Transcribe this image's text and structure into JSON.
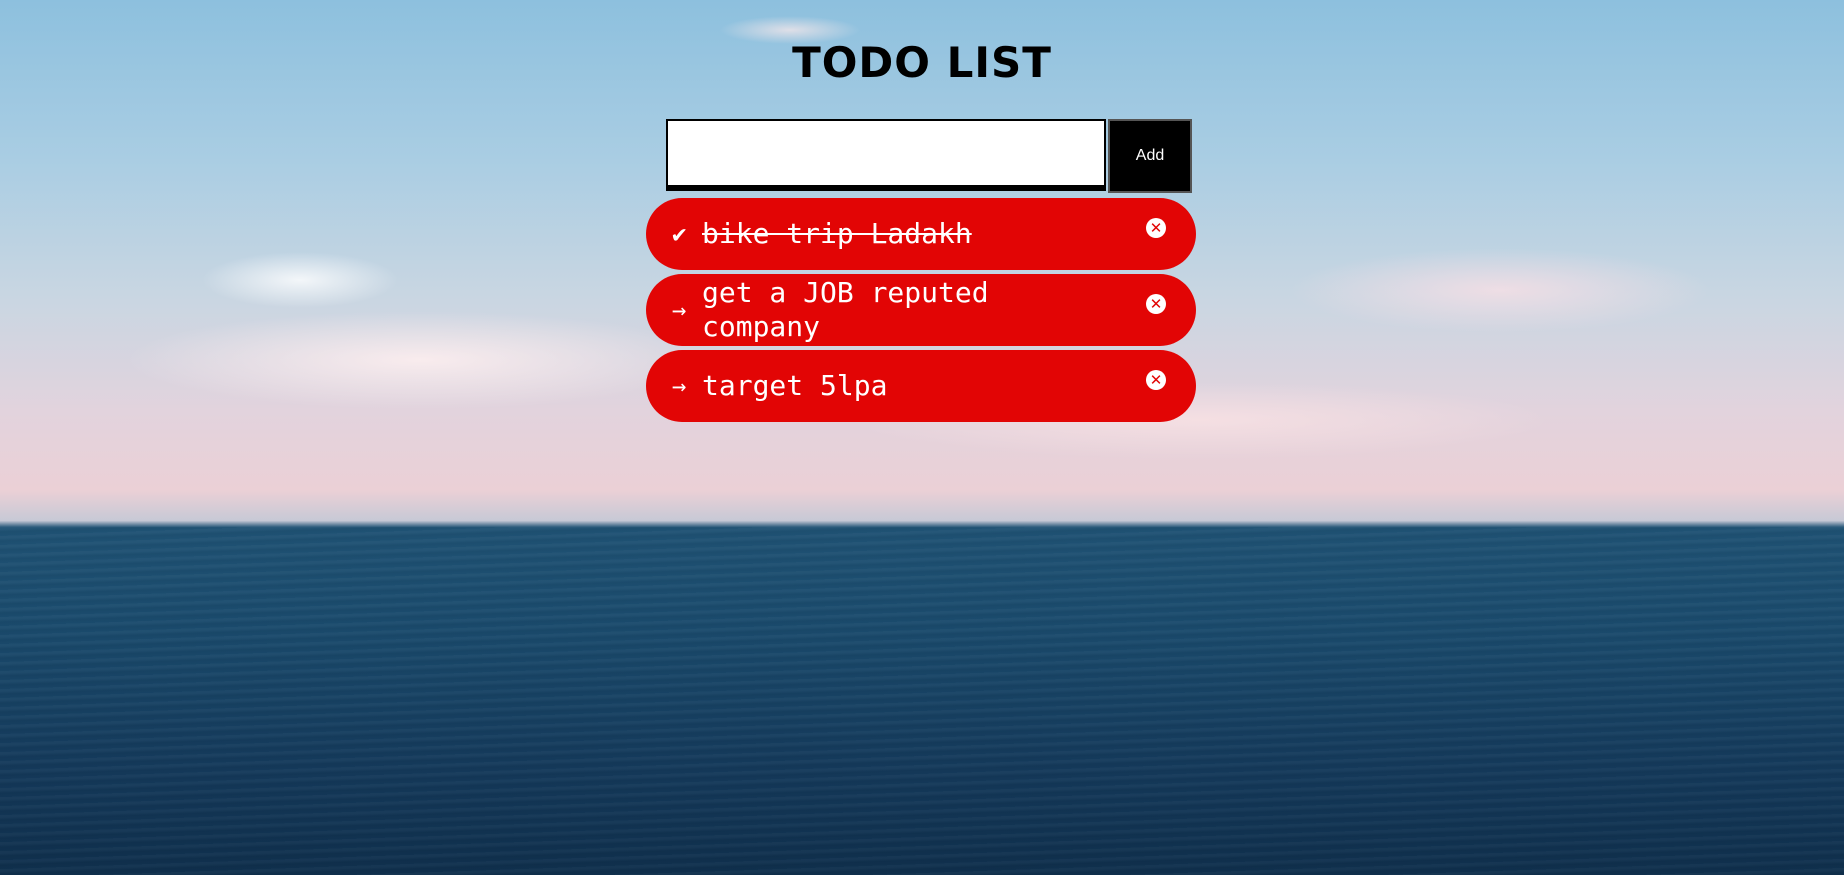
{
  "app": {
    "title": "TODO LIST"
  },
  "form": {
    "input_value": "",
    "input_placeholder": "",
    "add_label": "Add"
  },
  "todos": [
    {
      "text": "bike trip Ladakh",
      "done": true,
      "status_icon": "check-icon",
      "status_glyph": "✔"
    },
    {
      "text": "get a JOB reputed company",
      "done": false,
      "status_icon": "arrow-right-icon",
      "status_glyph": "→"
    },
    {
      "text": "target 5lpa",
      "done": false,
      "status_icon": "arrow-right-icon",
      "status_glyph": "→"
    }
  ],
  "icons": {
    "delete_glyph": "✕"
  },
  "colors": {
    "item_background": "#e20505",
    "button_background": "#000000"
  }
}
